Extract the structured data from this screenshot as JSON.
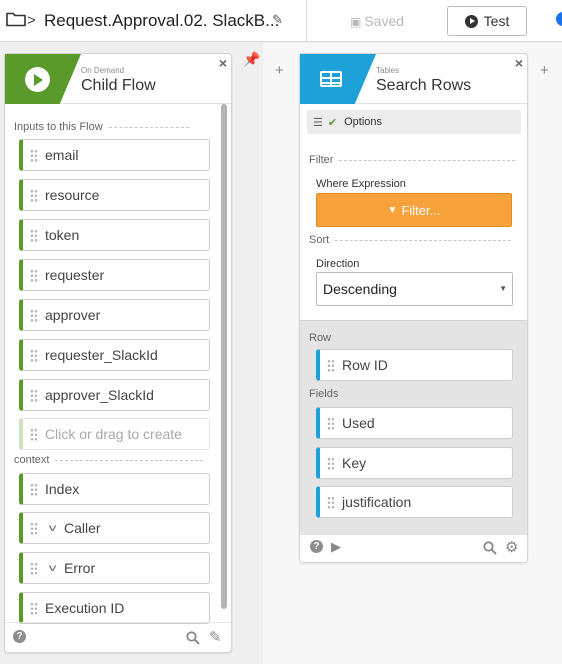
{
  "header": {
    "flow_title": "Request.Approval.02. SlackB...",
    "saved_label": "Saved",
    "test_label": "Test"
  },
  "child_flow": {
    "subtitle": "On Demand",
    "title": "Child Flow",
    "inputs_label": "Inputs to this Flow",
    "inputs": [
      "email",
      "resource",
      "token",
      "requester",
      "approver",
      "requester_SlackId",
      "approver_SlackId"
    ],
    "create_placeholder": "Click or drag to create",
    "context_label": "context",
    "context": {
      "index": "Index",
      "caller": "Caller",
      "error": "Error",
      "execution_id": "Execution ID"
    }
  },
  "search_rows": {
    "subtitle": "Tables",
    "title": "Search Rows",
    "options_label": "Options",
    "filter_label": "Filter",
    "where_label": "Where Expression",
    "filter_button": "Filter...",
    "sort_label": "Sort",
    "direction_label": "Direction",
    "direction_value": "Descending",
    "row_label": "Row",
    "row_id": "Row ID",
    "fields_label": "Fields",
    "fields": [
      "Used",
      "Key",
      "justification"
    ]
  },
  "colors": {
    "child_flow_accent": "#5a9a2a",
    "tables_accent": "#1da1d8",
    "filter_button": "#f7a13a",
    "pin": "#3a7bd5"
  },
  "icons": [
    "folder-icon",
    "chevron-right-icon",
    "pencil-icon",
    "save-icon",
    "play-circle-icon",
    "play-icon",
    "close-icon",
    "pin-icon",
    "plus-icon",
    "table-icon",
    "sliders-icon",
    "check-icon",
    "funnel-icon",
    "help-icon",
    "search-icon",
    "edit-icon",
    "chevron-down-icon"
  ]
}
